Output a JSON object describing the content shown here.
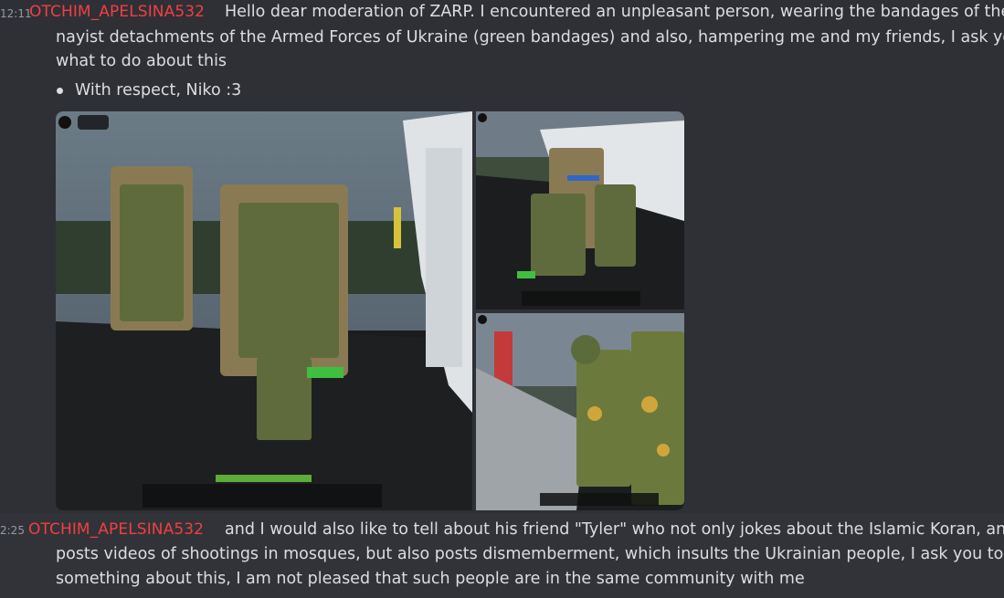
{
  "messages": [
    {
      "timestamp": "12:11",
      "author": "OTCHIM_APELSINA532",
      "lines": [
        "Hello dear moderation of ZARP. I encountered an unpleasant person, wearing the bandages of the",
        "nayist detachments of the Armed Forces of Ukraine (green bandages) and also, hampering me and my friends, I ask you",
        "what to do about this"
      ],
      "bullet": "With respect, Niko :3",
      "attachments": [
        {
          "name": "screenshot-1"
        },
        {
          "name": "screenshot-2"
        },
        {
          "name": "screenshot-3"
        }
      ]
    },
    {
      "timestamp": "2:25",
      "author": "OTCHIM_APELSINA532",
      "lines": [
        "and I would also like to tell about his friend \"Tyler\" who not only jokes about the Islamic Koran, and",
        "posts videos of shootings in mosques, but also posts dismemberment, which insults the Ukrainian people, I ask you to do",
        "something about this, I am not pleased that such people are in the same community with me"
      ]
    }
  ],
  "colors": {
    "background": "#313338",
    "hover_background": "#2e3035",
    "author": "#f23f43",
    "text": "#dbdee1",
    "timestamp": "#949ba4"
  }
}
